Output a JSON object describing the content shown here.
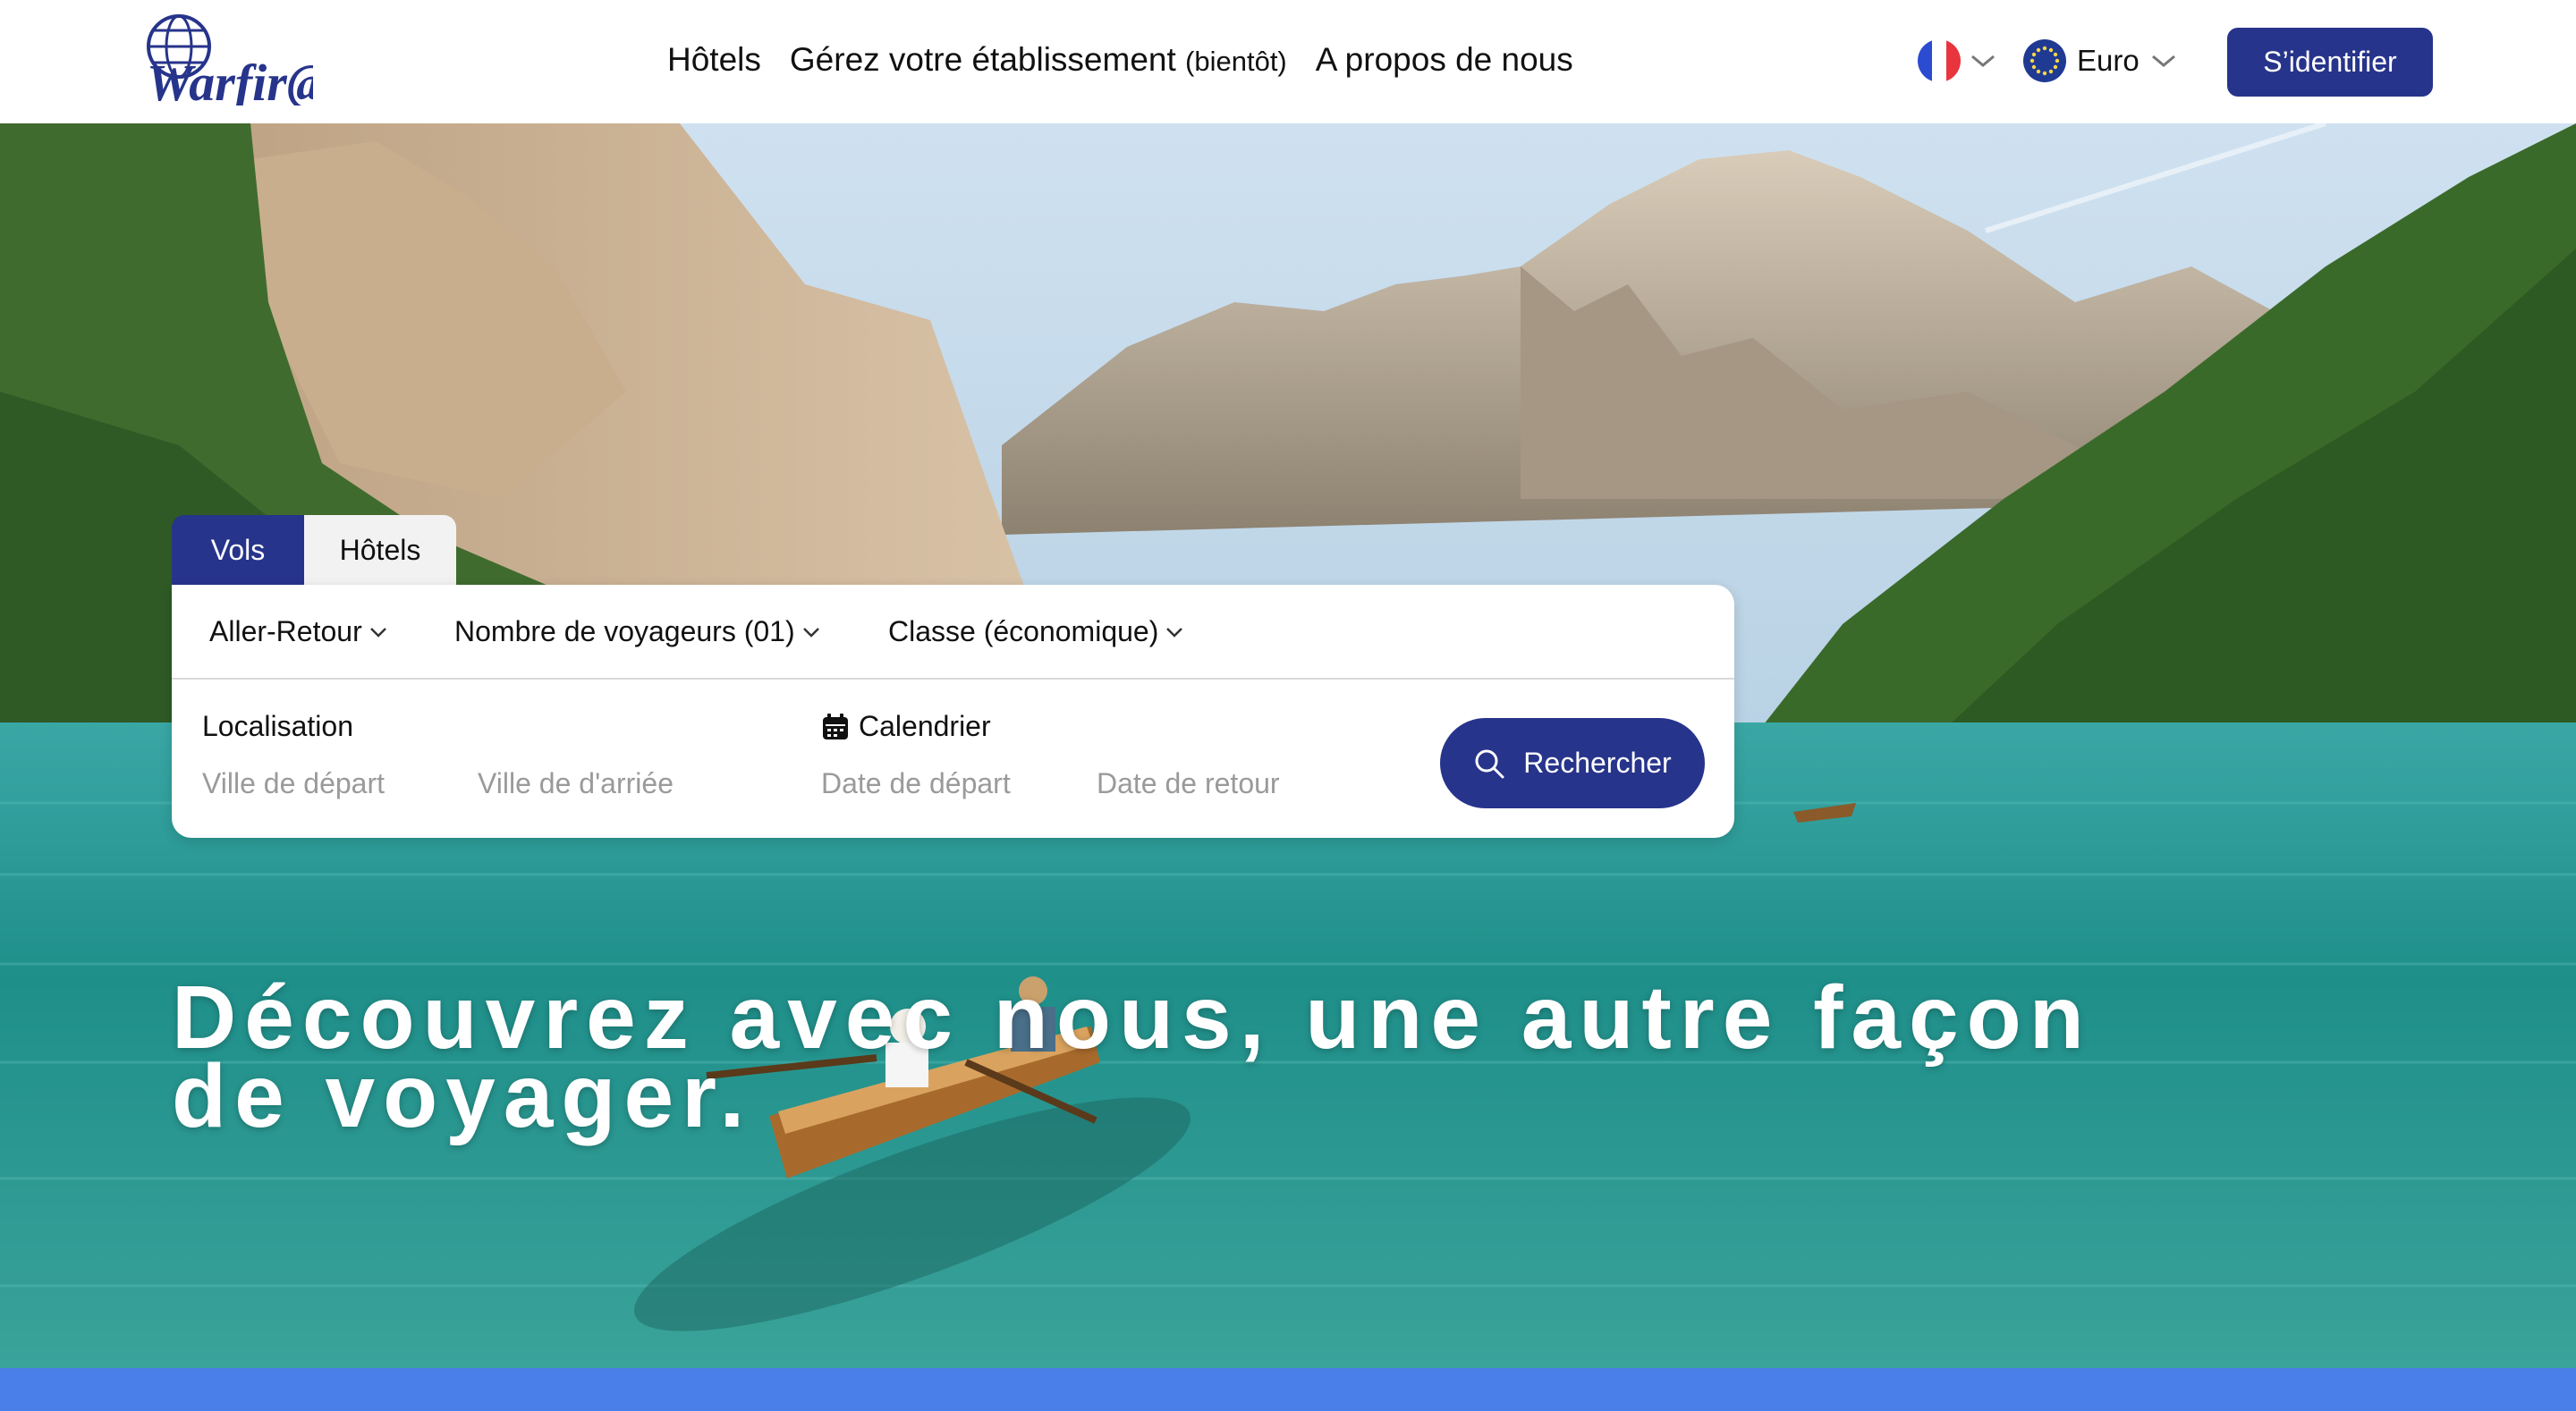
{
  "header": {
    "logo_text": "Warfir@",
    "nav": [
      {
        "label": "Hôtels"
      },
      {
        "label": "Gérez votre établissement",
        "suffix": "(bientôt)"
      },
      {
        "label": "A propos de nous"
      }
    ],
    "language": {
      "icon": "french-flag-icon"
    },
    "currency": {
      "label": "Euro",
      "icon": "eu-flag-icon"
    },
    "signin_label": "S’identifier"
  },
  "search": {
    "tabs": [
      {
        "label": "Vols",
        "active": true
      },
      {
        "label": "Hôtels",
        "active": false
      }
    ],
    "options": {
      "trip_type": "Aller-Retour",
      "travelers": "Nombre de voyageurs (01)",
      "class": "Classe (économique)"
    },
    "location": {
      "label": "Localisation",
      "departure_placeholder": "Ville de départ",
      "arrival_placeholder": "Ville de d'arriée"
    },
    "calendar": {
      "label": "Calendrier",
      "departure_placeholder": "Date de départ",
      "return_placeholder": "Date de retour"
    },
    "button_label": "Rechercher"
  },
  "hero": {
    "tagline_line1": "Découvrez avec nous, une autre façon",
    "tagline_line2": "de voyager."
  },
  "colors": {
    "brand": "#27348b",
    "bottom_bar": "#4a7ee8",
    "lake": "#238f8a"
  }
}
